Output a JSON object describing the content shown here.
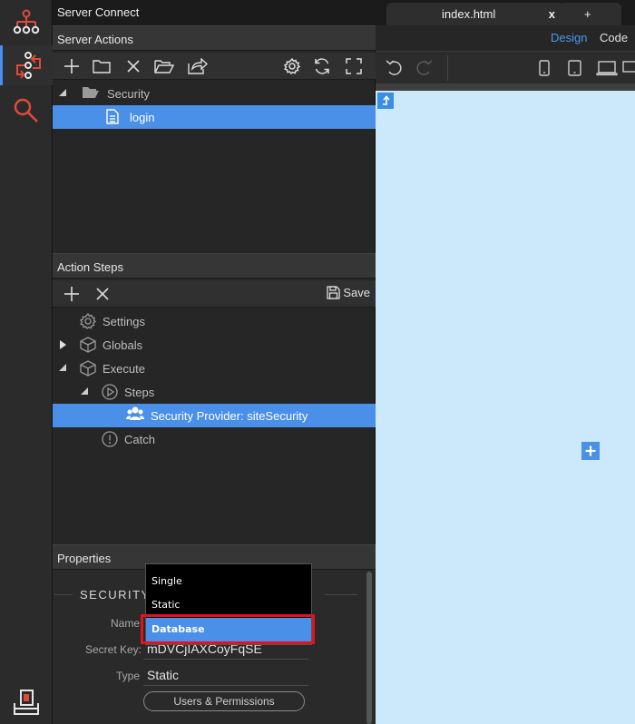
{
  "app": {
    "title": "Server Connect"
  },
  "server_actions": {
    "header": "Server Actions",
    "tree": [
      {
        "label": "Security",
        "type": "folder",
        "expanded": true
      },
      {
        "label": "login",
        "type": "file",
        "selected": true
      }
    ]
  },
  "action_steps": {
    "header": "Action Steps",
    "save_label": "Save",
    "tree": [
      {
        "label": "Settings"
      },
      {
        "label": "Globals"
      },
      {
        "label": "Execute"
      },
      {
        "label": "Steps"
      },
      {
        "label": "Security Provider: siteSecurity",
        "selected": true
      },
      {
        "label": "Catch"
      }
    ]
  },
  "properties": {
    "header": "Properties",
    "group_title_left": "SECURITY",
    "group_title_right": "S",
    "name_label": "Name",
    "secret_key_label": "Secret Key:",
    "secret_key_value": "mDVCjIAXCoyFqSE",
    "type_label": "Type",
    "type_value": "Static",
    "permissions_button": "Users & Permissions"
  },
  "dropdown": {
    "options": [
      "Single",
      "Static",
      "Database"
    ],
    "highlighted": "Database"
  },
  "editor": {
    "tab_label": "index.html",
    "tab_close": "x",
    "new_tab": "+",
    "design_label": "Design",
    "code_label": "Code"
  },
  "colors": {
    "accent": "#4a8fe8",
    "canvas": "#cce8fb",
    "highlight_box": "#e0141e",
    "icon_red": "#e04a3a"
  },
  "icons": {
    "rail": [
      "sitemap-icon",
      "server-connect-icon",
      "search-icon",
      "export-icon"
    ]
  }
}
